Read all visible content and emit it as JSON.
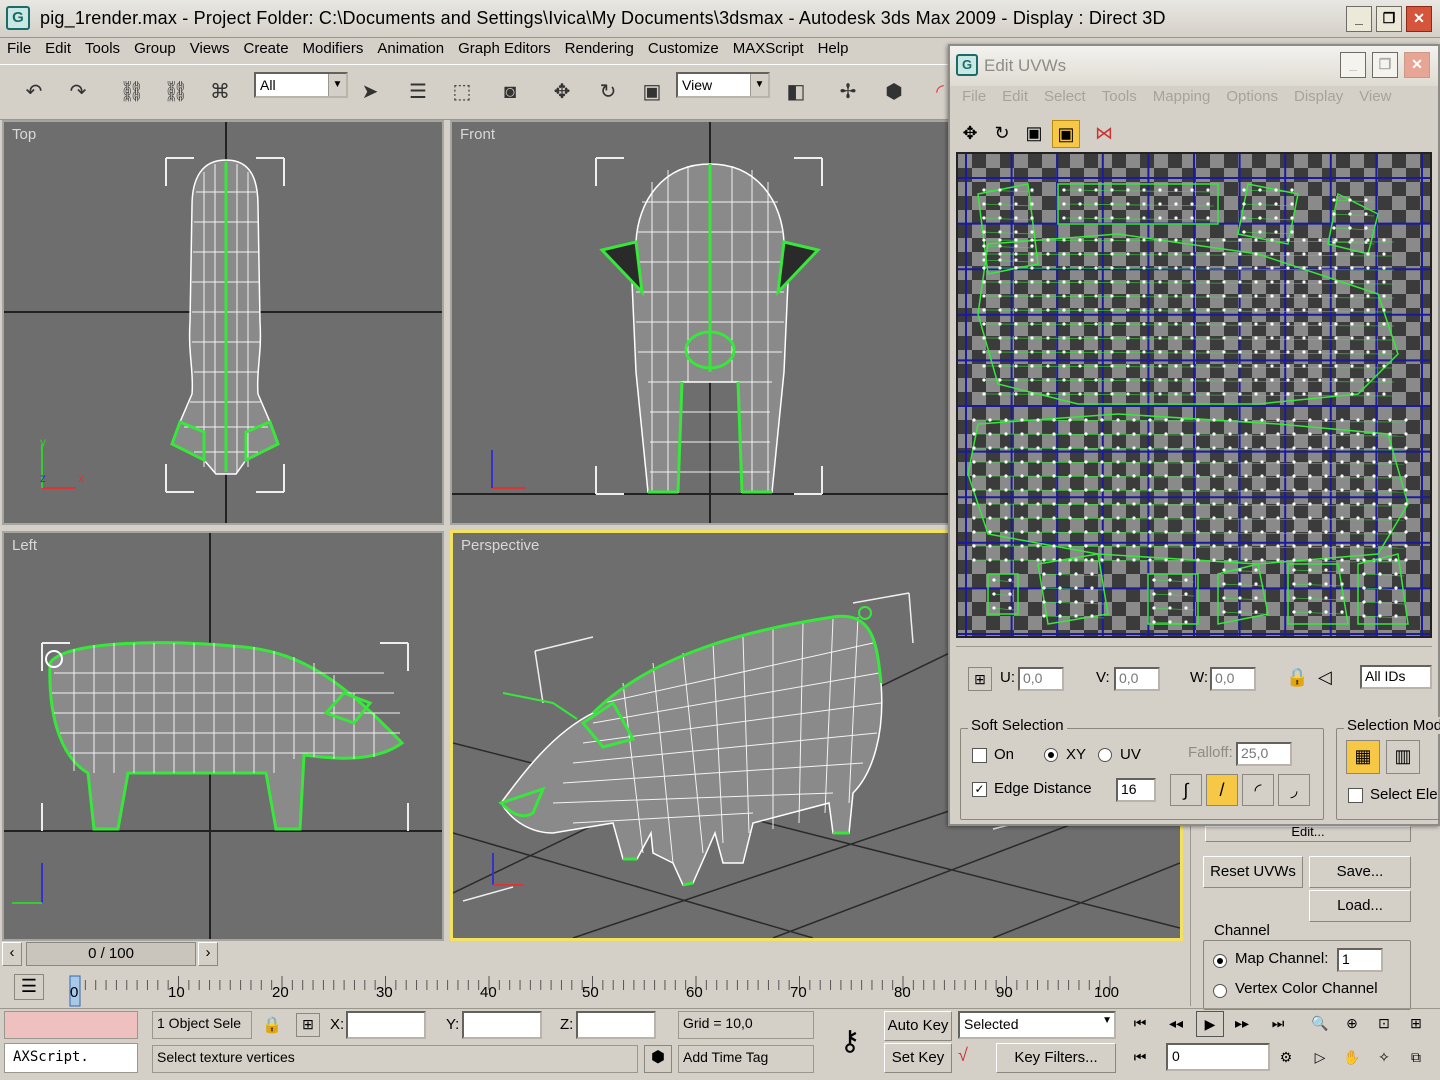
{
  "window": {
    "title": "pig_1render.max      - Project Folder: C:\\Documents and Settings\\Ivica\\My Documents\\3dsmax      - Autodesk 3ds Max  2009       - Display : Direct 3D",
    "minimize": "_",
    "maximize": "❐",
    "close": "✕"
  },
  "menu": [
    "File",
    "Edit",
    "Tools",
    "Group",
    "Views",
    "Create",
    "Modifiers",
    "Animation",
    "Graph Editors",
    "Rendering",
    "Customize",
    "MAXScript",
    "Help"
  ],
  "toolbar": {
    "selection_filter": "All",
    "reference_coord": "View"
  },
  "viewports": {
    "top": "Top",
    "front": "Front",
    "left": "Left",
    "perspective": "Perspective",
    "axis_x": "x",
    "axis_y": "y",
    "axis_z": "z"
  },
  "uv_editor": {
    "title": "Edit UVWs",
    "menu": [
      "File",
      "Edit",
      "Select",
      "Tools",
      "Mapping",
      "Options",
      "Display",
      "View"
    ],
    "u_label": "U:",
    "u_value": "0,0",
    "v_label": "V:",
    "v_value": "0,0",
    "w_label": "W:",
    "w_value": "0,0",
    "id_filter": "All IDs",
    "soft_selection": {
      "title": "Soft Selection",
      "on_label": "On",
      "on_checked": false,
      "xy_label": "XY",
      "uv_label": "UV",
      "falloff_label": "Falloff:",
      "falloff_value": "25,0",
      "edge_distance_label": "Edge Distance",
      "edge_distance_checked": true,
      "edge_distance_value": "16"
    },
    "selection_modes": {
      "title": "Selection Mod",
      "select_element_label": "Select Ele"
    }
  },
  "command_panel": {
    "edit_button": "Edit...",
    "reset_uvws": "Reset UVWs",
    "save": "Save...",
    "load": "Load...",
    "channel_title": "Channel",
    "map_channel_label": "Map Channel:",
    "map_channel_value": "1",
    "vertex_color_label": "Vertex Color Channel"
  },
  "timeline": {
    "frame_display": "0 / 100",
    "ticks": [
      "0",
      "10",
      "20",
      "30",
      "40",
      "50",
      "60",
      "70",
      "80",
      "90",
      "100"
    ],
    "current_frame": 0
  },
  "status": {
    "maxscript": "AXScript.",
    "selection_info": "1 Object Sele",
    "x_label": "X:",
    "y_label": "Y:",
    "z_label": "Z:",
    "grid": "Grid = 10,0",
    "prompt": "Select texture vertices",
    "add_time_tag": "Add Time Tag",
    "auto_key": "Auto Key",
    "set_key": "Set Key",
    "key_mode": "Selected",
    "key_filters": "Key Filters...",
    "frame_value": "0"
  },
  "colors": {
    "selection_green": "#38e63c",
    "uv_grid_blue": "#1b1b9b",
    "active_yellow": "#f3e25f"
  }
}
